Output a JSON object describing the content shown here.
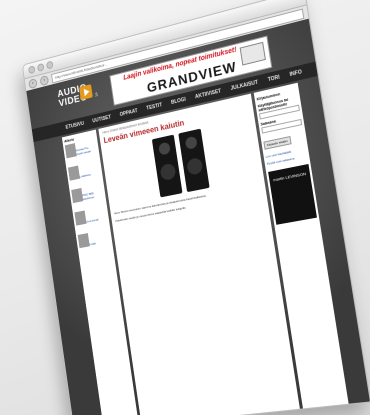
{
  "browser": {
    "url": "http://www.hifi-lehti.fi/audiovideo/..."
  },
  "site": {
    "logo_line1": "AUDIO",
    "logo_line2": "VIDEO",
    "logo_suffix": ".fi",
    "banner_tagline": "Laajin valikoima, nopeat toimitukset!",
    "banner_brand": "GRANDVIEW",
    "nav": [
      "ETUSIVU",
      "UUTISET",
      "OPPAAT",
      "TESTIT",
      "BLOGI",
      "AKTIIVISET",
      "JULKAISUT",
      "TORI",
      "INFO"
    ]
  },
  "left": {
    "heading": "Alkeis",
    "items": [
      "Kuinka Pro Audio kaiutin",
      "Lisätietoa",
      "PMC BB5 kaiuttimet",
      "Uusi trendi",
      "Lisää"
    ]
  },
  "article": {
    "crumb": "Hero Direkt lähikaiuttimet testissä",
    "title": "Leveän vimeeen kaiutin",
    "intro": "Hero Direkt muotoinen sanoma kaiuttimista ja tasapainoista kaiutinratkaisua.",
    "body": "Kaiuttimien testiä ja muuta tietoa saatavilla kaikille lukijoille."
  },
  "right": {
    "login_title": "Kirjautuminen",
    "user_label": "Käyttäjätunnus tai sähköpostiosoite",
    "password_label": "Salasana",
    "button": "Kirjaudu sisään",
    "links": [
      "Luo uusi käyttäjätili",
      "Pyydä uusi salasana"
    ],
    "ad_brand": "martin LEVINSON"
  }
}
